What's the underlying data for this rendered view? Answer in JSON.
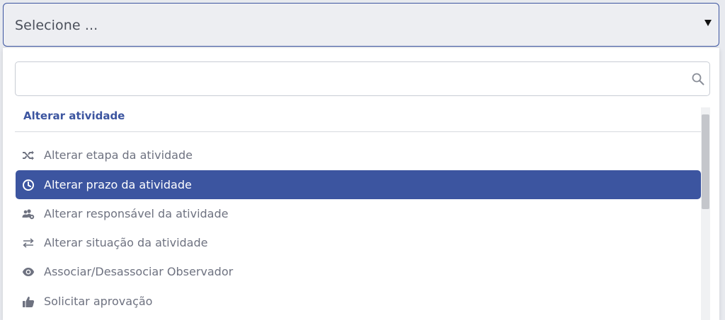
{
  "select": {
    "value": "Selecione ...",
    "arrow_icon": "caret-down-icon"
  },
  "search": {
    "value": "",
    "placeholder": "",
    "icon": "search-icon"
  },
  "group": {
    "label": "Alterar atividade"
  },
  "options": [
    {
      "label": "Alterar etapa da atividade",
      "icon": "shuffle-icon",
      "active": false
    },
    {
      "label": "Alterar prazo da atividade",
      "icon": "clock-icon",
      "active": true
    },
    {
      "label": "Alterar responsável da atividade",
      "icon": "users-gear-icon",
      "active": false
    },
    {
      "label": "Alterar situação da atividade",
      "icon": "exchange-arrows-icon",
      "active": false
    },
    {
      "label": "Associar/Desassociar Observador",
      "icon": "eye-icon",
      "active": false
    },
    {
      "label": "Solicitar aprovação",
      "icon": "thumbs-up-icon",
      "active": false
    }
  ],
  "colors": {
    "accent": "#3c55a0",
    "option_text": "#6e7280",
    "active_text": "#ffffff"
  }
}
